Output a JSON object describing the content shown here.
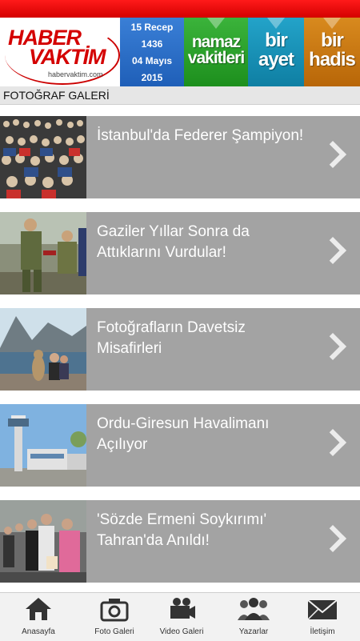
{
  "header": {
    "logo_line1": "HABER",
    "logo_line2": "VAKTİM",
    "logo_url": "habervaktim.com",
    "date_hijri_day_month": "15 Recep",
    "date_hijri_year": "1436",
    "date_day_month": "04 Mayıs",
    "date_year": "2015",
    "namaz_line1": "namaz",
    "namaz_line2": "vakitleri",
    "ayet_line1": "bir",
    "ayet_line2": "ayet",
    "hadis_line1": "bir",
    "hadis_line2": "hadis",
    "colors": {
      "topbar": "#e00000",
      "date": "#2a6fc9",
      "namaz": "#2aa52a",
      "ayet": "#1893ba",
      "hadis": "#c97712"
    }
  },
  "section": {
    "title": "FOTOĞRAF GALERİ"
  },
  "gallery": {
    "items": [
      {
        "title": "İstanbul'da Federer Şampiyon!",
        "icon": "chevron-right-icon"
      },
      {
        "title": "Gaziler Yıllar Sonra da Attıklarını Vurdular!",
        "icon": "chevron-right-icon"
      },
      {
        "title": "Fotoğrafların Davetsiz Misafirleri",
        "icon": "chevron-right-icon"
      },
      {
        "title": "Ordu-Giresun Havalimanı Açılıyor",
        "icon": "chevron-right-icon"
      },
      {
        "title": "'Sözde Ermeni Soykırımı' Tahran'da Anıldı!",
        "icon": "chevron-right-icon"
      }
    ]
  },
  "tabbar": {
    "tabs": [
      {
        "label": "Anasayfa",
        "icon": "home-icon"
      },
      {
        "label": "Foto Galeri",
        "icon": "camera-icon"
      },
      {
        "label": "Video Galeri",
        "icon": "video-camera-icon"
      },
      {
        "label": "Yazarlar",
        "icon": "users-icon"
      },
      {
        "label": "İletişim",
        "icon": "envelope-icon"
      }
    ]
  }
}
